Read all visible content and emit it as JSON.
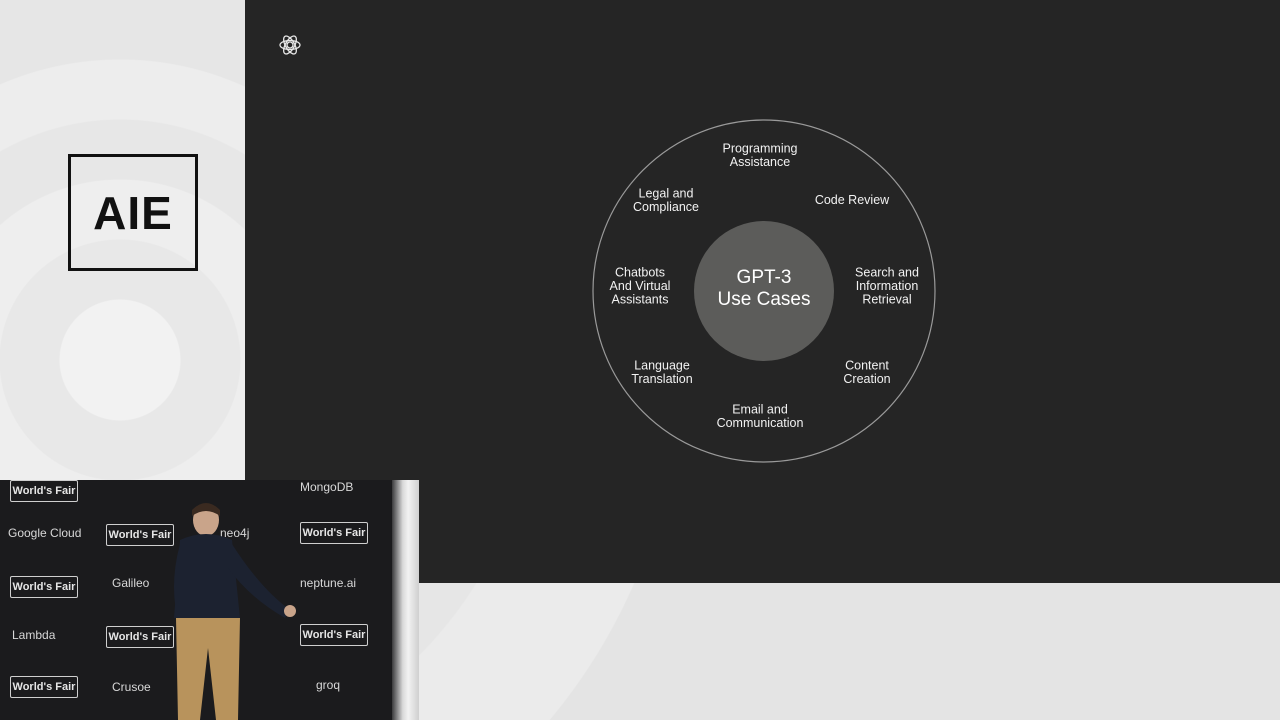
{
  "logo": {
    "text": "AIE"
  },
  "slide": {
    "icon": "openai-logo-icon",
    "diagram": {
      "center": [
        "GPT-3",
        "Use Cases"
      ],
      "segments": [
        {
          "lines": [
            "Programming",
            "Assistance"
          ]
        },
        {
          "lines": [
            "Code Review"
          ]
        },
        {
          "lines": [
            "Search and",
            "Information",
            "Retrieval"
          ]
        },
        {
          "lines": [
            "Content",
            "Creation"
          ]
        },
        {
          "lines": [
            "Email and",
            "Communication"
          ]
        },
        {
          "lines": [
            "Language",
            "Translation"
          ]
        },
        {
          "lines": [
            "Chatbots",
            "And Virtual",
            "Assistants"
          ]
        },
        {
          "lines": [
            "Legal and",
            "Compliance"
          ]
        }
      ],
      "colors": {
        "background": "#252525",
        "ring": "#9a9a9a",
        "center_fill": "#5c5c5a",
        "text": "#f2f2f2"
      }
    }
  },
  "camera": {
    "sponsors": [
      "World's Fair",
      "MongoDB",
      "Google Cloud",
      "World's Fair",
      "neo4j",
      "World's Fair",
      "World's Fair",
      "Galileo",
      "neptune.ai",
      "Lambda",
      "World's Fair",
      "World's Fair",
      "World's Fair",
      "Crusoe",
      "groq"
    ]
  }
}
